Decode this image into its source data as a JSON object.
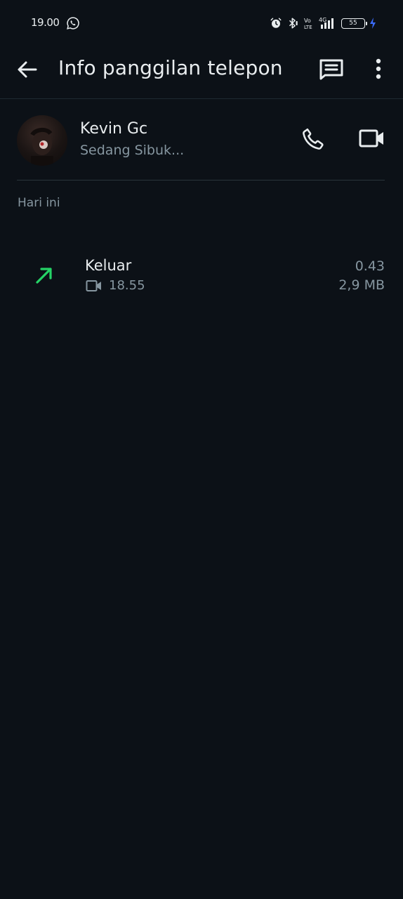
{
  "status_bar": {
    "time": "19.00",
    "battery_level": "55",
    "network_label": "4G",
    "volte_label": "Vo LTE",
    "icons": [
      "whatsapp-icon",
      "alarm-icon",
      "bluetooth-icon",
      "volte-icon",
      "signal-icon",
      "battery-icon",
      "charging-icon"
    ]
  },
  "toolbar": {
    "title": "Info panggilan telepon",
    "icons": [
      "back-arrow-icon",
      "message-icon",
      "more-vert-icon"
    ]
  },
  "contact": {
    "name": "Kevin Gc",
    "status": "Sedang Sibuk...",
    "icons": [
      "phone-icon",
      "video-call-icon"
    ]
  },
  "section": {
    "label": "Hari ini"
  },
  "calls": [
    {
      "direction": "Keluar",
      "time": "18.55",
      "duration": "0.43",
      "size": "2,9 MB",
      "type_icon": "video-camera-icon",
      "direction_icon": "outgoing-arrow-icon",
      "direction_color": "#25d366"
    }
  ],
  "colors": {
    "background": "#0c1117",
    "primary_text": "#e9edef",
    "secondary_text": "#8696a0",
    "accent_green": "#25d366",
    "charging": "#3b6cff"
  }
}
